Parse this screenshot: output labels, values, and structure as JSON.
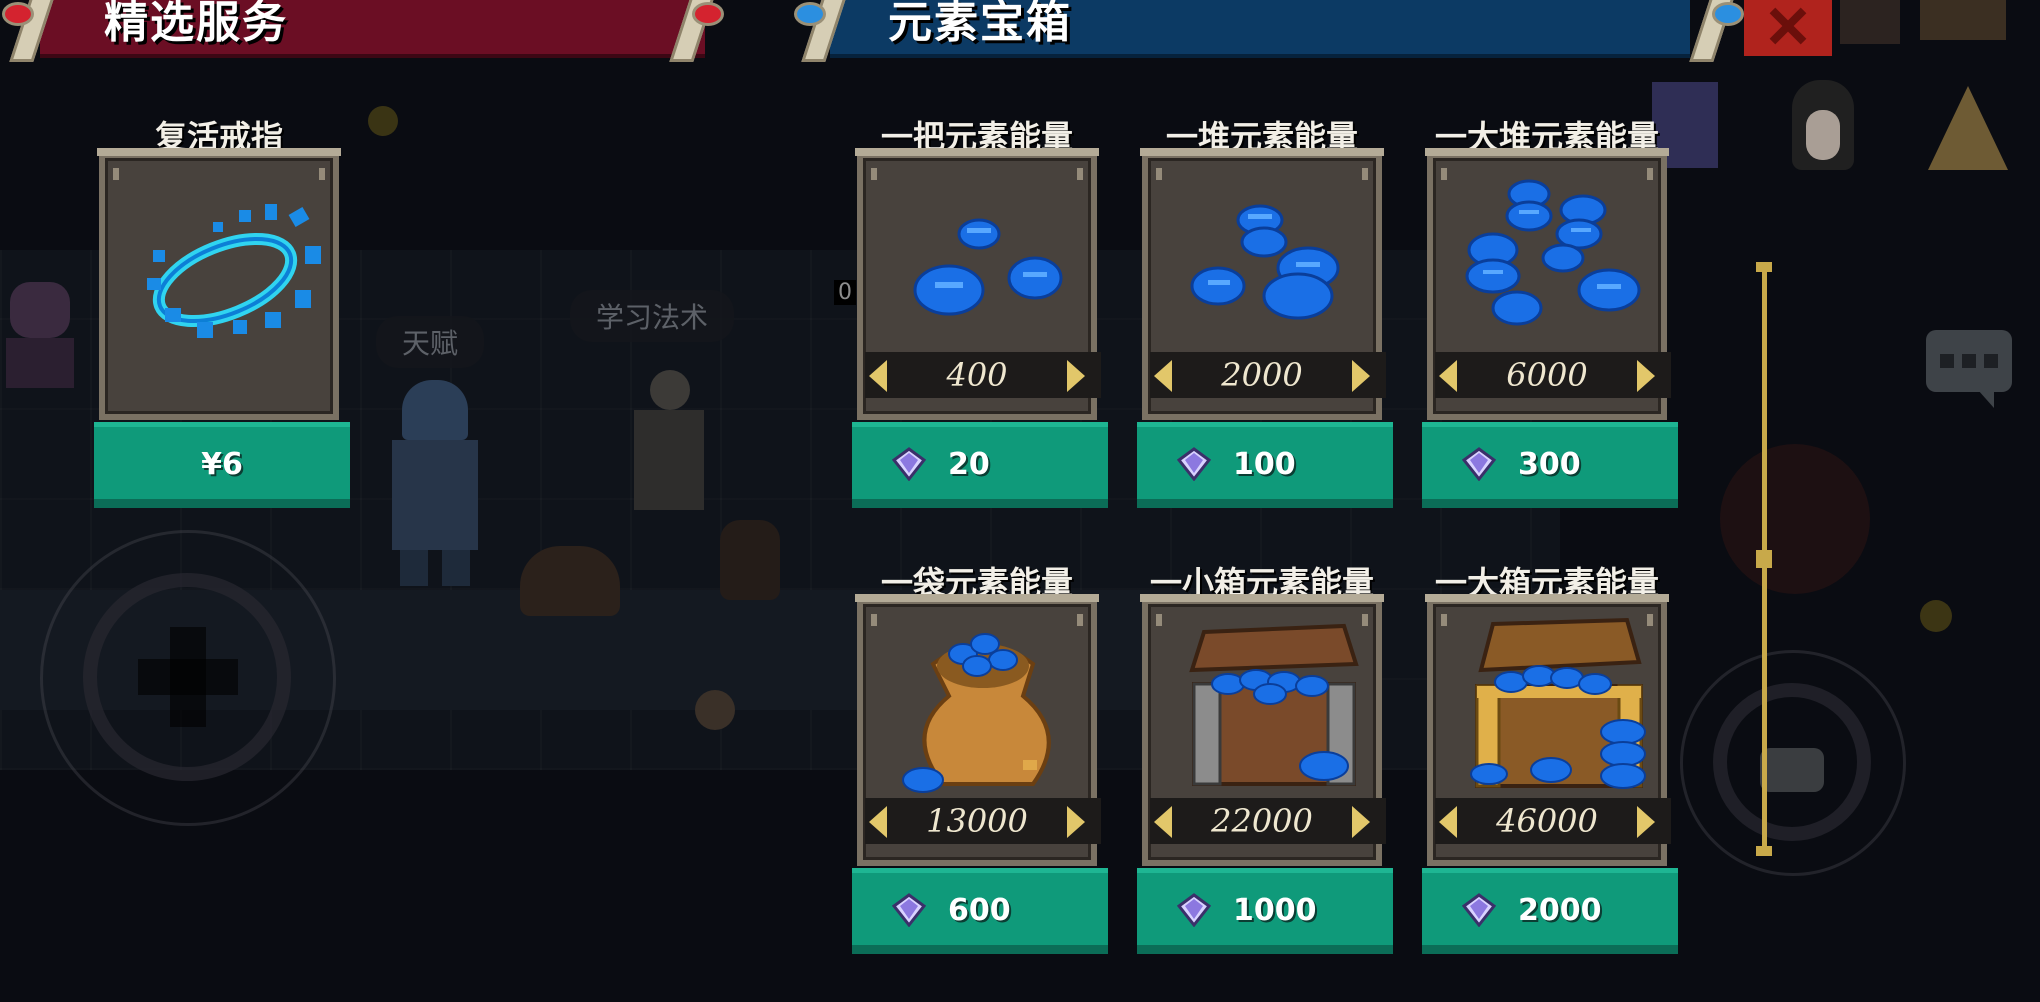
{
  "banners": {
    "featured": "精选服务",
    "element_chest": "元素宝箱"
  },
  "background": {
    "talent_label": "天赋",
    "learn_spell_label": "学习法术",
    "hud_number": "0"
  },
  "featured_item": {
    "name": "复活戒指",
    "price": "¥6"
  },
  "products": [
    {
      "name": "一把元素能量",
      "quantity": "400",
      "price": "20"
    },
    {
      "name": "一堆元素能量",
      "quantity": "2000",
      "price": "100"
    },
    {
      "name": "一大堆元素能量",
      "quantity": "6000",
      "price": "300"
    },
    {
      "name": "一袋元素能量",
      "quantity": "13000",
      "price": "600"
    },
    {
      "name": "一小箱元素能量",
      "quantity": "22000",
      "price": "1000"
    },
    {
      "name": "一大箱元素能量",
      "quantity": "46000",
      "price": "2000"
    }
  ],
  "icons": {
    "currency": "gem-icon",
    "ring": "revive-ring-icon",
    "coins": "energy-coin-icon",
    "bag": "coin-bag-icon",
    "chest": "treasure-chest-icon",
    "chat": "chat-icon",
    "close": "close-icon"
  },
  "colors": {
    "featured_banner": "#6b0e24",
    "chest_banner": "#0c3a64",
    "button": "#0f9a7a",
    "coin": "#1a6fe6"
  }
}
